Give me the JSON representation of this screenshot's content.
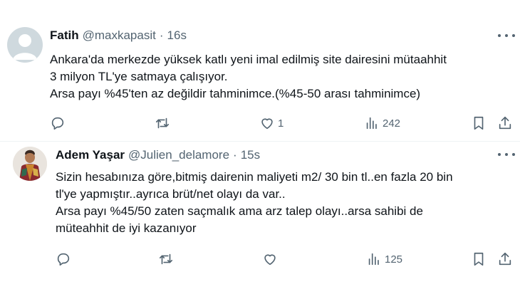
{
  "tweets": [
    {
      "author_name": "Fatih",
      "handle": "@maxkapasit",
      "separator": "·",
      "time": "16s",
      "lines": [
        "Ankara'da merkezde yüksek katlı yeni imal edilmiş site dairesini mütaahhit",
        "3 milyon TL'ye satmaya çalışıyor.",
        "Arsa payı %45'ten az değildir tahminimce.(%45-50 arası tahminimce)"
      ],
      "replies": "",
      "reposts": "",
      "likes": "1",
      "views": "242"
    },
    {
      "author_name": "Adem Yaşar",
      "handle": "@Julien_delamore",
      "separator": "·",
      "time": "15s",
      "lines": [
        "Sizin hesabınıza göre,bitmiş dairenin maliyeti m2/ 30 bin tl..en fazla 20 bin",
        "tl'ye yapmıştır..ayrıca brüt/net olayı da var..",
        "Arsa payı %45/50 zaten saçmalık ama arz talep olayı..arsa sahibi de",
        "müteahhit de iyi kazanıyor"
      ],
      "replies": "",
      "reposts": "",
      "likes": "",
      "views": "125"
    }
  ],
  "icons": [
    "more-icon",
    "reply-icon",
    "repost-icon",
    "like-icon",
    "views-icon",
    "bookmark-icon",
    "share-icon"
  ],
  "colors": {
    "text": "#0f1419",
    "secondary": "#536471",
    "divider": "#eff3f4",
    "avatar_placeholder": "#cfd9de"
  }
}
